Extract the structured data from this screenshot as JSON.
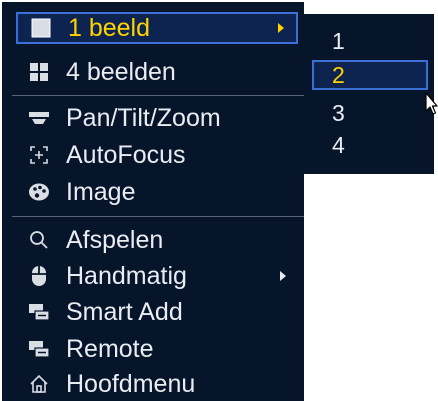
{
  "menu": {
    "items": [
      {
        "label": "1 beeld",
        "icon": "single-view-icon",
        "has_submenu": true,
        "selected": true
      },
      {
        "label": "4 beelden",
        "icon": "quad-view-icon",
        "has_submenu": false
      },
      {
        "label": "Pan/Tilt/Zoom",
        "icon": "ptz-icon",
        "has_submenu": false
      },
      {
        "label": "AutoFocus",
        "icon": "autofocus-icon",
        "has_submenu": false
      },
      {
        "label": "Image",
        "icon": "palette-icon",
        "has_submenu": false
      },
      {
        "label": "Afspelen",
        "icon": "search-icon",
        "has_submenu": false
      },
      {
        "label": "Handmatig",
        "icon": "mouse-icon",
        "has_submenu": true
      },
      {
        "label": "Smart Add",
        "icon": "network-device-icon",
        "has_submenu": false
      },
      {
        "label": "Remote",
        "icon": "network-device-icon",
        "has_submenu": false
      },
      {
        "label": "Hoofdmenu",
        "icon": "home-icon",
        "has_submenu": false
      }
    ]
  },
  "submenu": {
    "items": [
      {
        "label": "1"
      },
      {
        "label": "2",
        "selected": true
      },
      {
        "label": "3"
      },
      {
        "label": "4"
      }
    ]
  },
  "colors": {
    "menu_background": "#07152a",
    "text": "#e9edf3",
    "highlight_text": "#ffd200",
    "highlight_border": "#3a6fd6"
  }
}
